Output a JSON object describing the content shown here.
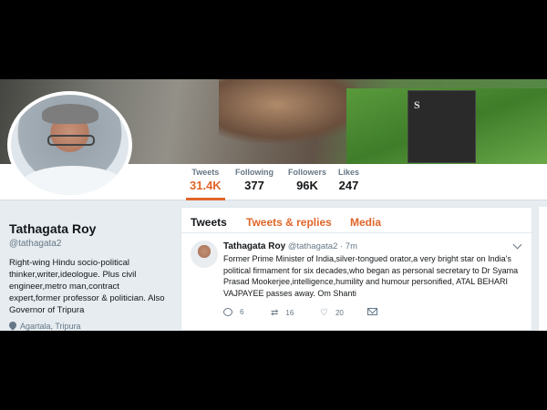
{
  "header": {
    "stats": [
      {
        "label": "Tweets",
        "value": "31.4K",
        "active": true
      },
      {
        "label": "Following",
        "value": "377"
      },
      {
        "label": "Followers",
        "value": "96K"
      },
      {
        "label": "Likes",
        "value": "247"
      }
    ],
    "banner_sign_text": "S"
  },
  "profile": {
    "name": "Tathagata Roy",
    "handle": "@tathagata2",
    "bio": "Right-wing Hindu socio-political thinker,writer,ideologue. Plus civil engineer,metro man,contract expert,former professor & politician. Also Governor of Tripura",
    "location": "Agartala, Tripura"
  },
  "timeline": {
    "tabs": [
      "Tweets",
      "Tweets & replies",
      "Media"
    ],
    "tweet": {
      "name": "Tathagata Roy",
      "handle": "@tathagata2",
      "time": "· 7m",
      "text": "Former Prime Minister of India,silver-tongued orator,a very bright star on India's political firmament for six decades,who began as personal secretary to Dr Syama Prasad Mookerjee,intelligence,humility and humour  personified, ATAL BEHARI VAJPAYEE passes away. Om Shanti",
      "replies": "6",
      "retweets": "16",
      "likes": "20"
    }
  },
  "colors": {
    "accent": "#e0662a",
    "text": "#14171a",
    "muted": "#657786",
    "background": "#e6ecf0"
  }
}
